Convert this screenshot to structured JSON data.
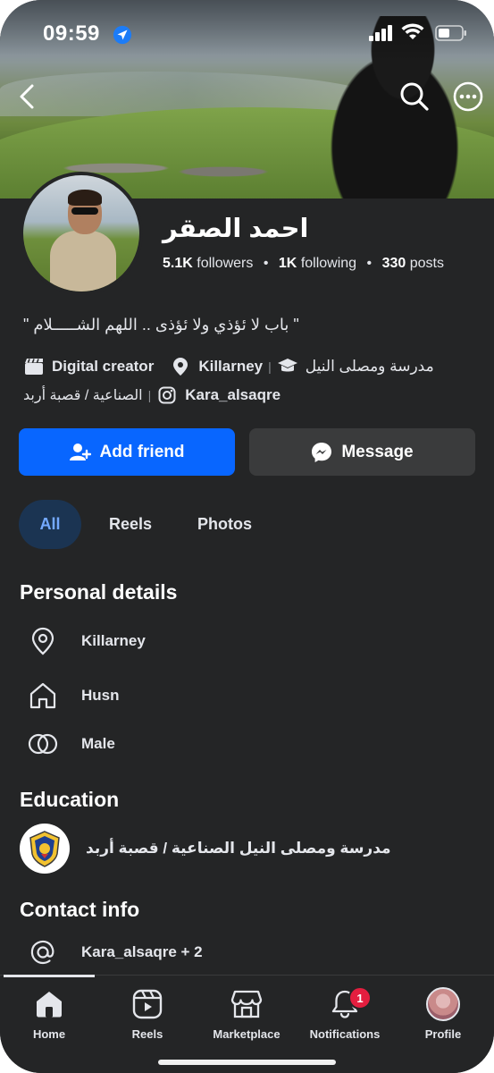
{
  "status_bar": {
    "time": "09:59"
  },
  "profile": {
    "name": "احمد الصقر",
    "stats": {
      "followers_value": "5.1K",
      "followers_label": "followers",
      "following_value": "1K",
      "following_label": "following",
      "posts_value": "330",
      "posts_label": "posts",
      "separator": "•"
    },
    "bio": "\" باب لا ئؤذي ولا ئؤذى .. اللهم الشـــــلام \"",
    "info": {
      "category": "Digital creator",
      "location": "Killarney",
      "school": "مدرسة ومصلى النيل",
      "school_continued": "الصناعية / قصبة أربد",
      "instagram": "Kara_alsaqre",
      "separator": "|"
    }
  },
  "actions": {
    "add_friend": "Add friend",
    "message": "Message"
  },
  "tabs": [
    {
      "label": "All",
      "active": true
    },
    {
      "label": "Reels",
      "active": false
    },
    {
      "label": "Photos",
      "active": false
    }
  ],
  "personal_details": {
    "title": "Personal details",
    "items": [
      {
        "icon": "location-pin-icon",
        "text": "Killarney"
      },
      {
        "icon": "home-icon",
        "text": "Husn"
      },
      {
        "icon": "gender-rings-icon",
        "text": "Male"
      }
    ]
  },
  "education": {
    "title": "Education",
    "school": "مدرسة ومصلى النيل الصناعية / قصبة أربد"
  },
  "contact": {
    "title": "Contact info",
    "item": "Kara_alsaqre + 2"
  },
  "nav": {
    "items": [
      {
        "label": "Home",
        "icon": "home-icon"
      },
      {
        "label": "Reels",
        "icon": "reels-icon"
      },
      {
        "label": "Marketplace",
        "icon": "marketplace-icon"
      },
      {
        "label": "Notifications",
        "icon": "bell-icon",
        "badge": "1"
      },
      {
        "label": "Profile",
        "icon": "profile-avatar"
      }
    ]
  },
  "colors": {
    "background": "#242526",
    "primary_button": "#0866ff",
    "secondary_button": "#3a3b3c",
    "active_tab_bg": "#1b3452",
    "active_tab_text": "#74a9ff",
    "badge": "#e41e3f"
  }
}
